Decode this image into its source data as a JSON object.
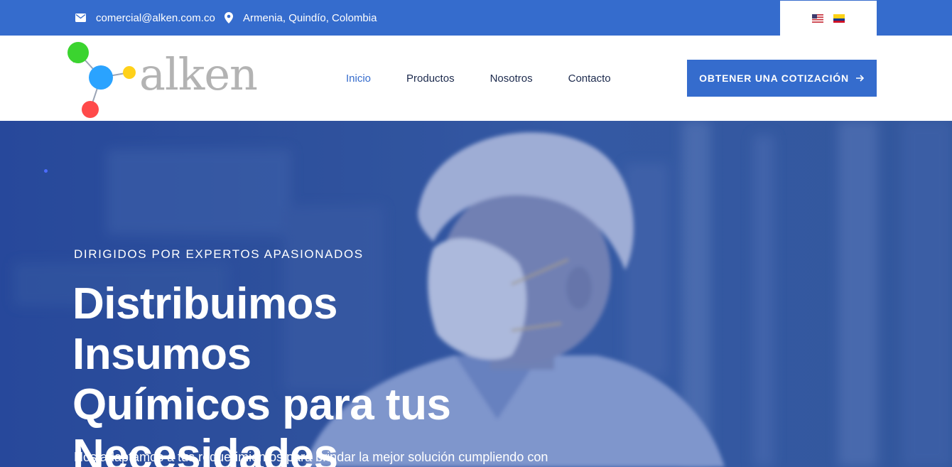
{
  "topbar": {
    "email": "comercial@alken.com.co",
    "location": "Armenia, Quindío, Colombia",
    "email_icon": "envelope-icon",
    "location_icon": "map-pin-icon",
    "languages": [
      "flag-us-icon",
      "flag-colombia-icon"
    ]
  },
  "header": {
    "logo_text": "alken",
    "nav": [
      "Inicio",
      "Productos",
      "Nosotros",
      "Contacto"
    ],
    "active_nav": "Inicio",
    "cta_label": "OBTENER UNA COTIZACIÓN",
    "cta_icon": "arrow-right-icon"
  },
  "hero": {
    "eyebrow": "DIRIGIDOS POR EXPERTOS APASIONADOS",
    "headline_lines": [
      "Distribuimos Insumos",
      "Químicos para tus",
      "Necesidades"
    ],
    "subtext": "Nos adaptamos a tus requerimientos para brindar la mejor solución cumpliendo con"
  },
  "colors": {
    "brand_blue": "#356ccd",
    "nav_text": "#1c2a4d",
    "logo_green": "#3bd42f",
    "logo_blue": "#2aa3ff",
    "logo_yellow": "#ffd11a",
    "logo_red": "#ff4a4a"
  }
}
